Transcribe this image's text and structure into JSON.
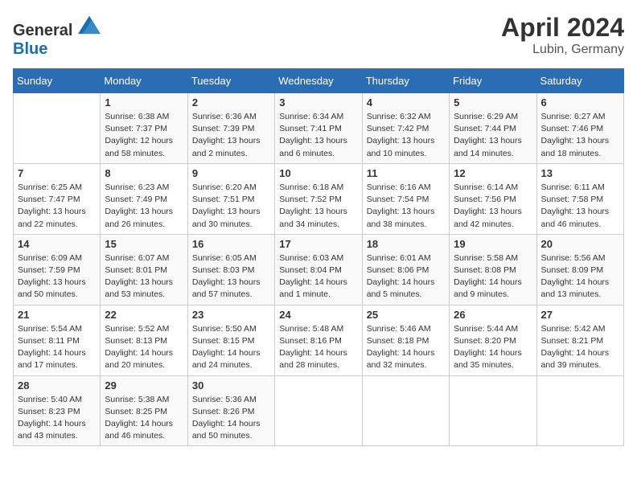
{
  "header": {
    "logo_general": "General",
    "logo_blue": "Blue",
    "month_year": "April 2024",
    "location": "Lubin, Germany"
  },
  "columns": [
    "Sunday",
    "Monday",
    "Tuesday",
    "Wednesday",
    "Thursday",
    "Friday",
    "Saturday"
  ],
  "weeks": [
    [
      {
        "day": "",
        "info": ""
      },
      {
        "day": "1",
        "info": "Sunrise: 6:38 AM\nSunset: 7:37 PM\nDaylight: 12 hours and 58 minutes."
      },
      {
        "day": "2",
        "info": "Sunrise: 6:36 AM\nSunset: 7:39 PM\nDaylight: 13 hours and 2 minutes."
      },
      {
        "day": "3",
        "info": "Sunrise: 6:34 AM\nSunset: 7:41 PM\nDaylight: 13 hours and 6 minutes."
      },
      {
        "day": "4",
        "info": "Sunrise: 6:32 AM\nSunset: 7:42 PM\nDaylight: 13 hours and 10 minutes."
      },
      {
        "day": "5",
        "info": "Sunrise: 6:29 AM\nSunset: 7:44 PM\nDaylight: 13 hours and 14 minutes."
      },
      {
        "day": "6",
        "info": "Sunrise: 6:27 AM\nSunset: 7:46 PM\nDaylight: 13 hours and 18 minutes."
      }
    ],
    [
      {
        "day": "7",
        "info": "Sunrise: 6:25 AM\nSunset: 7:47 PM\nDaylight: 13 hours and 22 minutes."
      },
      {
        "day": "8",
        "info": "Sunrise: 6:23 AM\nSunset: 7:49 PM\nDaylight: 13 hours and 26 minutes."
      },
      {
        "day": "9",
        "info": "Sunrise: 6:20 AM\nSunset: 7:51 PM\nDaylight: 13 hours and 30 minutes."
      },
      {
        "day": "10",
        "info": "Sunrise: 6:18 AM\nSunset: 7:52 PM\nDaylight: 13 hours and 34 minutes."
      },
      {
        "day": "11",
        "info": "Sunrise: 6:16 AM\nSunset: 7:54 PM\nDaylight: 13 hours and 38 minutes."
      },
      {
        "day": "12",
        "info": "Sunrise: 6:14 AM\nSunset: 7:56 PM\nDaylight: 13 hours and 42 minutes."
      },
      {
        "day": "13",
        "info": "Sunrise: 6:11 AM\nSunset: 7:58 PM\nDaylight: 13 hours and 46 minutes."
      }
    ],
    [
      {
        "day": "14",
        "info": "Sunrise: 6:09 AM\nSunset: 7:59 PM\nDaylight: 13 hours and 50 minutes."
      },
      {
        "day": "15",
        "info": "Sunrise: 6:07 AM\nSunset: 8:01 PM\nDaylight: 13 hours and 53 minutes."
      },
      {
        "day": "16",
        "info": "Sunrise: 6:05 AM\nSunset: 8:03 PM\nDaylight: 13 hours and 57 minutes."
      },
      {
        "day": "17",
        "info": "Sunrise: 6:03 AM\nSunset: 8:04 PM\nDaylight: 14 hours and 1 minute."
      },
      {
        "day": "18",
        "info": "Sunrise: 6:01 AM\nSunset: 8:06 PM\nDaylight: 14 hours and 5 minutes."
      },
      {
        "day": "19",
        "info": "Sunrise: 5:58 AM\nSunset: 8:08 PM\nDaylight: 14 hours and 9 minutes."
      },
      {
        "day": "20",
        "info": "Sunrise: 5:56 AM\nSunset: 8:09 PM\nDaylight: 14 hours and 13 minutes."
      }
    ],
    [
      {
        "day": "21",
        "info": "Sunrise: 5:54 AM\nSunset: 8:11 PM\nDaylight: 14 hours and 17 minutes."
      },
      {
        "day": "22",
        "info": "Sunrise: 5:52 AM\nSunset: 8:13 PM\nDaylight: 14 hours and 20 minutes."
      },
      {
        "day": "23",
        "info": "Sunrise: 5:50 AM\nSunset: 8:15 PM\nDaylight: 14 hours and 24 minutes."
      },
      {
        "day": "24",
        "info": "Sunrise: 5:48 AM\nSunset: 8:16 PM\nDaylight: 14 hours and 28 minutes."
      },
      {
        "day": "25",
        "info": "Sunrise: 5:46 AM\nSunset: 8:18 PM\nDaylight: 14 hours and 32 minutes."
      },
      {
        "day": "26",
        "info": "Sunrise: 5:44 AM\nSunset: 8:20 PM\nDaylight: 14 hours and 35 minutes."
      },
      {
        "day": "27",
        "info": "Sunrise: 5:42 AM\nSunset: 8:21 PM\nDaylight: 14 hours and 39 minutes."
      }
    ],
    [
      {
        "day": "28",
        "info": "Sunrise: 5:40 AM\nSunset: 8:23 PM\nDaylight: 14 hours and 43 minutes."
      },
      {
        "day": "29",
        "info": "Sunrise: 5:38 AM\nSunset: 8:25 PM\nDaylight: 14 hours and 46 minutes."
      },
      {
        "day": "30",
        "info": "Sunrise: 5:36 AM\nSunset: 8:26 PM\nDaylight: 14 hours and 50 minutes."
      },
      {
        "day": "",
        "info": ""
      },
      {
        "day": "",
        "info": ""
      },
      {
        "day": "",
        "info": ""
      },
      {
        "day": "",
        "info": ""
      }
    ]
  ]
}
